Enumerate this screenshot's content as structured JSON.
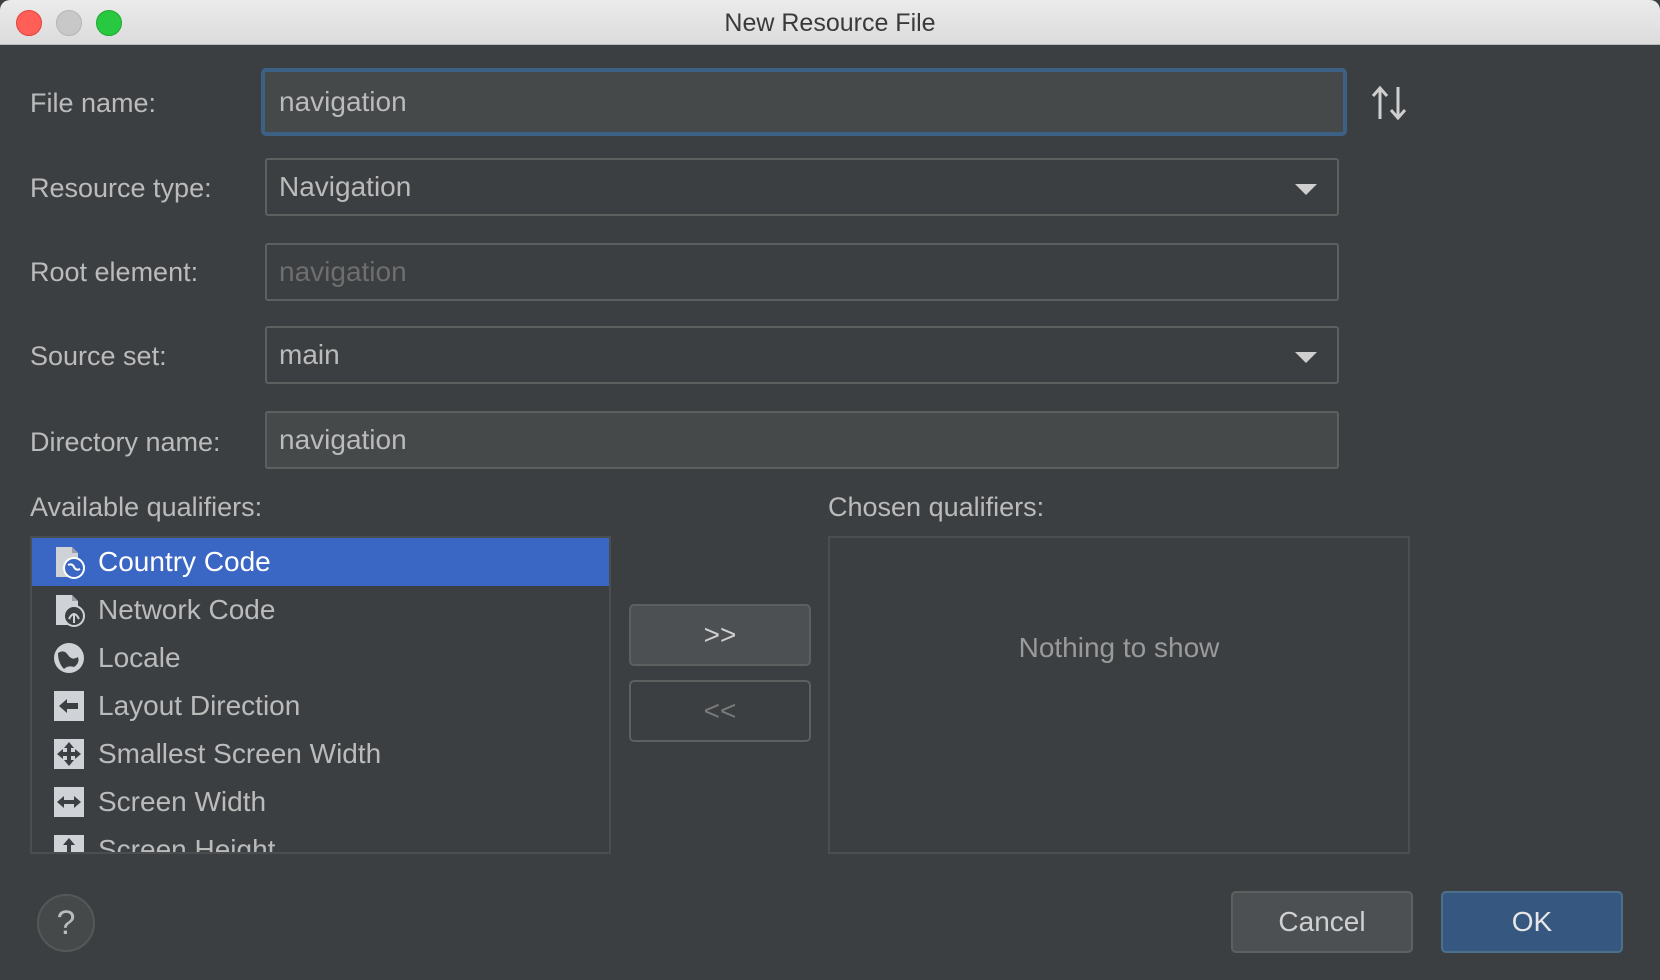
{
  "window": {
    "title": "New Resource File"
  },
  "form": {
    "file_name_label": "File name:",
    "file_name_value": "navigation",
    "resource_type_label": "Resource type:",
    "resource_type_value": "Navigation",
    "root_element_label": "Root element:",
    "root_element_placeholder": "navigation",
    "source_set_label": "Source set:",
    "source_set_value": "main",
    "directory_name_label": "Directory name:",
    "directory_name_value": "navigation"
  },
  "qualifiers": {
    "available_label": "Available qualifiers:",
    "chosen_label": "Chosen qualifiers:",
    "available": [
      {
        "label": "Country Code",
        "icon": "country-code-icon",
        "selected": true
      },
      {
        "label": "Network Code",
        "icon": "network-code-icon",
        "selected": false
      },
      {
        "label": "Locale",
        "icon": "globe-icon",
        "selected": false
      },
      {
        "label": "Layout Direction",
        "icon": "layout-direction-icon",
        "selected": false
      },
      {
        "label": "Smallest Screen Width",
        "icon": "smallest-width-icon",
        "selected": false
      },
      {
        "label": "Screen Width",
        "icon": "screen-width-icon",
        "selected": false
      },
      {
        "label": "Screen Height",
        "icon": "screen-height-icon",
        "selected": false
      }
    ],
    "chosen_empty_text": "Nothing to show",
    "add_label": ">>",
    "remove_label": "<<"
  },
  "buttons": {
    "help": "?",
    "cancel": "Cancel",
    "ok": "OK"
  },
  "colors": {
    "background": "#3c3f41",
    "selection": "#3a66c4",
    "focus_border": "#3d6185",
    "ok_button": "#365880"
  }
}
